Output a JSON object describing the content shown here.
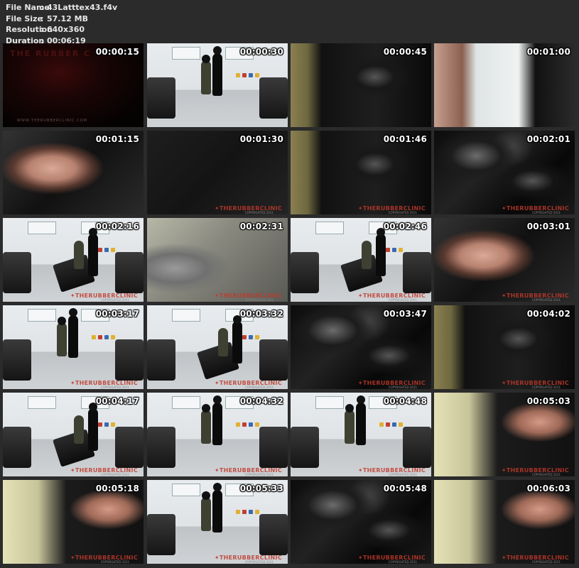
{
  "info": {
    "rows": [
      {
        "label": "File Name",
        "value": "43Latttex43.f4v"
      },
      {
        "label": "File Size",
        "value": "57.12 MB"
      },
      {
        "label": "Resolution",
        "value": "640x360"
      },
      {
        "label": "Duration",
        "value": "00:06:19"
      }
    ]
  },
  "thumbnails": [
    {
      "time": "00:00:15",
      "scene": "dark-red",
      "title_overlay": "THE RUBBER C",
      "url_overlay": "WWW.THERUBBERCLINIC.COM"
    },
    {
      "time": "00:00:30",
      "scene": "clinic-standing"
    },
    {
      "time": "00:00:45",
      "scene": "latex-yellow"
    },
    {
      "time": "00:01:00",
      "scene": "face-cabinet"
    },
    {
      "time": "00:01:15",
      "scene": "face"
    },
    {
      "time": "00:01:30",
      "scene": "dark",
      "watermark": "THERUBBERCLINIC",
      "copyright": "COPYRIGHTED 2011"
    },
    {
      "time": "00:01:46",
      "scene": "latex-yellow",
      "watermark": "THERUBBERCLINIC",
      "copyright": "COPYRIGHTED 2011"
    },
    {
      "time": "00:02:01",
      "scene": "latex",
      "watermark": "THERUBBERCLINIC",
      "copyright": "COPYRIGHTED 2011"
    },
    {
      "time": "00:02:16",
      "scene": "clinic-chair",
      "watermark": "THERUBBERCLINIC",
      "copyright": "COPYRIGHTED 2011"
    },
    {
      "time": "00:02:31",
      "scene": "grey-blur",
      "watermark": "THERUBBERCLINIC",
      "copyright": "COPYRIGHTED 2011"
    },
    {
      "time": "00:02:46",
      "scene": "clinic-chair",
      "watermark": "THERUBBERCLINIC",
      "copyright": "COPYRIGHTED 2011"
    },
    {
      "time": "00:03:01",
      "scene": "face",
      "watermark": "THERUBBERCLINIC",
      "copyright": "COPYRIGHTED 2011"
    },
    {
      "time": "00:03:17",
      "scene": "clinic-standing",
      "watermark": "THERUBBERCLINIC",
      "copyright": "COPYRIGHTED 2011"
    },
    {
      "time": "00:03:32",
      "scene": "clinic-chair",
      "watermark": "THERUBBERCLINIC",
      "copyright": "COPYRIGHTED 2011"
    },
    {
      "time": "00:03:47",
      "scene": "latex",
      "watermark": "THERUBBERCLINIC",
      "copyright": "COPYRIGHTED 2011"
    },
    {
      "time": "00:04:02",
      "scene": "latex-yellow",
      "watermark": "THERUBBERCLINIC",
      "copyright": "COPYRIGHTED 2011"
    },
    {
      "time": "00:04:17",
      "scene": "clinic-chair",
      "watermark": "THERUBBERCLINIC",
      "copyright": "COPYRIGHTED 2011"
    },
    {
      "time": "00:04:32",
      "scene": "clinic-standing",
      "watermark": "THERUBBERCLINIC",
      "copyright": "COPYRIGHTED 2011"
    },
    {
      "time": "00:04:48",
      "scene": "clinic-standing",
      "watermark": "THERUBBERCLINIC",
      "copyright": "COPYRIGHTED 2011"
    },
    {
      "time": "00:05:03",
      "scene": "face-bright",
      "watermark": "THERUBBERCLINIC",
      "copyright": "COPYRIGHTED 2011"
    },
    {
      "time": "00:05:18",
      "scene": "face-bright",
      "watermark": "THERUBBERCLINIC",
      "copyright": "COPYRIGHTED 2011"
    },
    {
      "time": "00:05:33",
      "scene": "clinic-standing",
      "watermark": "THERUBBERCLINIC",
      "copyright": "COPYRIGHTED 2011"
    },
    {
      "time": "00:05:48",
      "scene": "latex",
      "watermark": "THERUBBERCLINIC",
      "copyright": "COPYRIGHTED 2011"
    },
    {
      "time": "00:06:03",
      "scene": "face-bright",
      "watermark": "THERUBBERCLINIC",
      "copyright": "COPYRIGHTED 2011"
    }
  ]
}
